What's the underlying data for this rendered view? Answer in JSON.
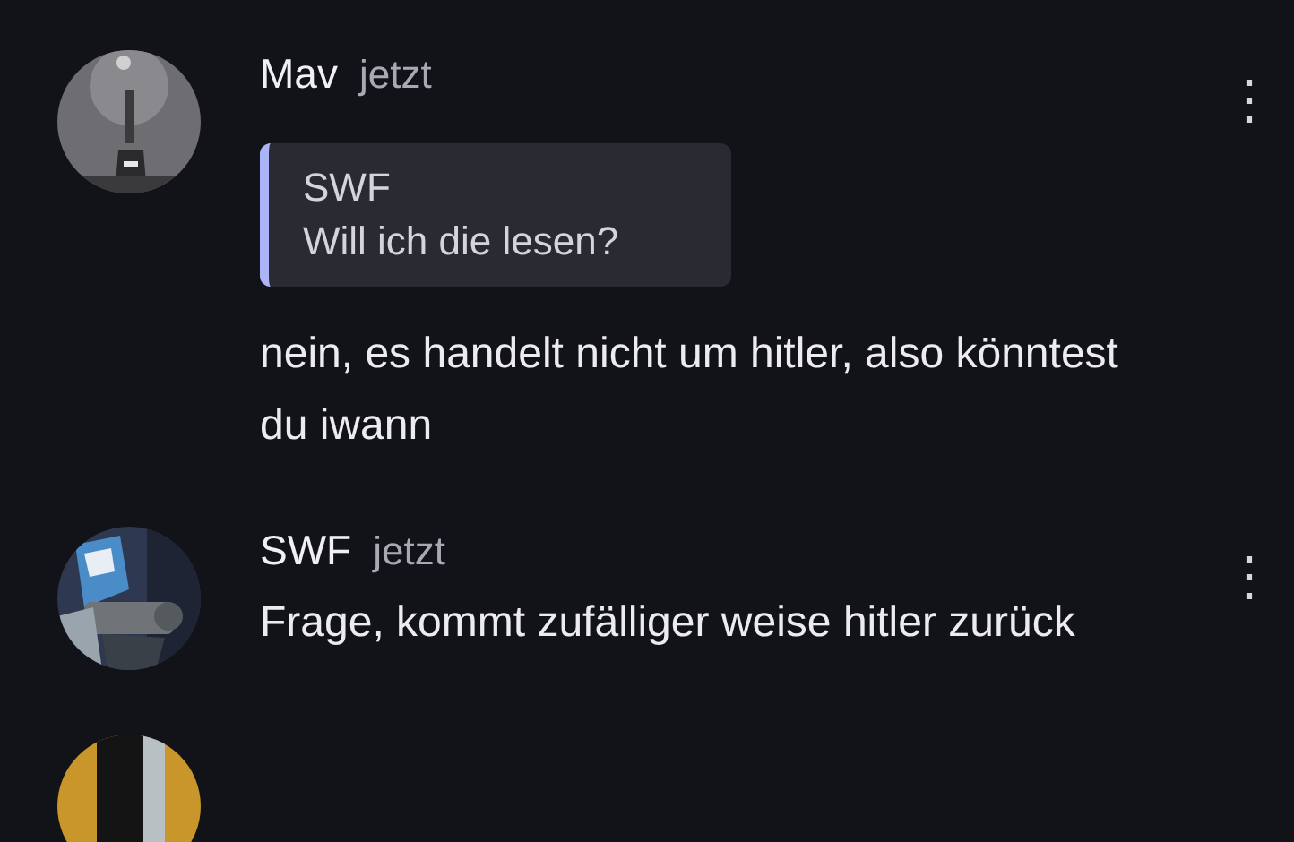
{
  "messages": [
    {
      "author": "Mav",
      "time": "jetzt",
      "avatar": {
        "kind": "picture"
      },
      "quote": {
        "author": "SWF",
        "text": "Will ich die lesen?"
      },
      "text": "nein, es handelt nicht um hitler, also könntest du iwann",
      "menu": "⋮"
    },
    {
      "author": "SWF",
      "time": "jetzt",
      "avatar": {
        "kind": "picture"
      },
      "text": "Frage, kommt zufälliger weise hitler zurück",
      "menu": "⋮"
    },
    {
      "avatar": {
        "kind": "picture"
      }
    }
  ]
}
